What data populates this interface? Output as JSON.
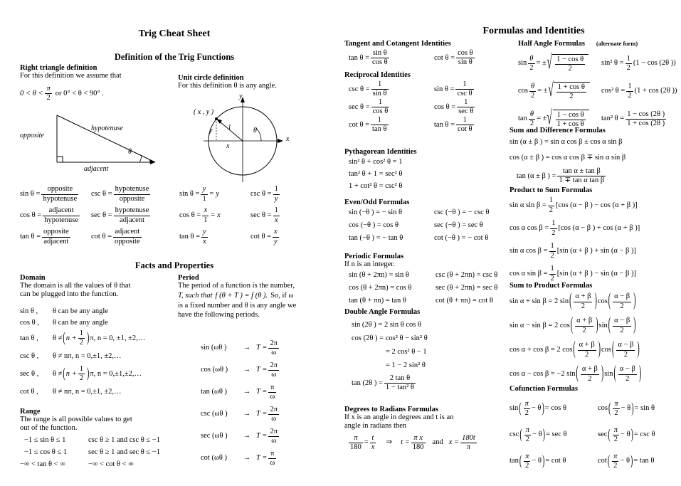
{
  "doc": {
    "title": "Trig Cheat Sheet",
    "right_title": "Formulas and Identities"
  },
  "left": {
    "section1_title": "Definition of the Trig Functions",
    "right_triangle": {
      "heading": "Right triangle definition",
      "line1": "For this definition we assume that",
      "inequality_a": "0 < θ <",
      "inequality_frac_num": "π",
      "inequality_frac_den": "2",
      "inequality_b": "or 0° < θ < 90° .",
      "diagram_labels": {
        "opposite": "opposite",
        "hypotenuse": "hypotenuse",
        "adjacent": "adjacent",
        "theta": "θ"
      },
      "formulas": [
        {
          "lhs": "sin θ =",
          "num": "opposite",
          "den": "hypotenuse"
        },
        {
          "lhs": "cos θ =",
          "num": "adjacent",
          "den": "hypotenuse"
        },
        {
          "lhs": "tan θ =",
          "num": "opposite",
          "den": "adjacent"
        },
        {
          "lhs": "csc θ =",
          "num": "hypotenuse",
          "den": "opposite"
        },
        {
          "lhs": "sec θ =",
          "num": "hypotenuse",
          "den": "adjacent"
        },
        {
          "lhs": "cot θ =",
          "num": "adjacent",
          "den": "opposite"
        }
      ]
    },
    "unit_circle": {
      "heading": "Unit circle definition",
      "line1": "For this definition θ is any angle.",
      "diagram_labels": {
        "point": "( x , y )",
        "x_axis": "x",
        "y_axis": "y",
        "radius": "1",
        "x_leg": "x",
        "y_leg": "y",
        "theta": "θ"
      },
      "formulas": [
        {
          "lhs": "sin θ =",
          "num": "y",
          "den": "1",
          "tail": "= y"
        },
        {
          "lhs": "cos θ =",
          "num": "x",
          "den": "1",
          "tail": "= x"
        },
        {
          "lhs": "tan θ =",
          "num": "y",
          "den": "x",
          "tail": ""
        },
        {
          "lhs": "csc θ =",
          "num": "1",
          "den": "y",
          "tail": ""
        },
        {
          "lhs": "sec θ =",
          "num": "1",
          "den": "x",
          "tail": ""
        },
        {
          "lhs": "cot θ =",
          "num": "x",
          "den": "y",
          "tail": ""
        }
      ]
    },
    "section2_title": "Facts and Properties",
    "domain": {
      "heading": "Domain",
      "line1": "The domain is all the values of θ that",
      "line2": "can be plugged into the function.",
      "rows": [
        {
          "fn": "sin θ ,",
          "cond": "θ can be any angle",
          "type": "plain"
        },
        {
          "fn": "cos θ ,",
          "cond": "θ can be any angle",
          "type": "plain"
        },
        {
          "fn": "tan θ ,",
          "cond": "",
          "type": "half",
          "tail": "π,  n = 0, ±1, ±2,…"
        },
        {
          "fn": "csc θ ,",
          "cond": "θ ≠ nπ,  n = 0,±1, ±2,…",
          "type": "plain"
        },
        {
          "fn": "sec θ ,",
          "cond": "",
          "type": "half",
          "tail": "π,  n = 0,±1,±2,…"
        },
        {
          "fn": "cot θ ,",
          "cond": "θ ≠ nπ,  n = 0,±1, ±2,…",
          "type": "plain"
        }
      ],
      "half_prefix": "θ ≠",
      "half_n": "n +",
      "half_num": "1",
      "half_den": "2"
    },
    "range": {
      "heading": "Range",
      "line1": "The range is all possible values to get",
      "line2": "out of the function.",
      "rows": [
        {
          "left": "−1 ≤ sin θ ≤ 1",
          "right": "csc θ ≥ 1 and csc θ ≤ −1"
        },
        {
          "left": "−1 ≤ cos θ ≤ 1",
          "right": "sec θ ≥ 1 and sec θ ≤ −1"
        },
        {
          "left": "−∞ < tan θ < ∞",
          "right": "−∞ < cot θ < ∞"
        }
      ]
    },
    "period": {
      "heading": "Period",
      "line1": "The period of a function is the number,",
      "line2_a": "T, such that",
      "line2_b": "f (θ + T ) = f (θ ).",
      "line2_c": "So, if ω",
      "line3": "is a fixed number and θ is any angle we",
      "line4": "have the following periods.",
      "rows": [
        {
          "fn": "sin (ωθ )",
          "arrow": "→",
          "eq": "T =",
          "num": "2π",
          "den": "ω"
        },
        {
          "fn": "cos (ωθ )",
          "arrow": "→",
          "eq": "T =",
          "num": "2π",
          "den": "ω"
        },
        {
          "fn": "tan (ωθ )",
          "arrow": "→",
          "eq": "T =",
          "num": "π",
          "den": "ω"
        },
        {
          "fn": "csc (ωθ )",
          "arrow": "→",
          "eq": "T =",
          "num": "2π",
          "den": "ω"
        },
        {
          "fn": "sec (ωθ )",
          "arrow": "→",
          "eq": "T =",
          "num": "2π",
          "den": "ω"
        },
        {
          "fn": "cot (ωθ )",
          "arrow": "→",
          "eq": "T =",
          "num": "π",
          "den": "ω"
        }
      ]
    }
  },
  "mid": {
    "tangent_cotangent": {
      "heading": "Tangent and Cotangent Identities",
      "rows": [
        {
          "lhs": "tan θ =",
          "num": "sin θ",
          "den": "cos θ"
        },
        {
          "lhs": "cot θ =",
          "num": "cos θ",
          "den": "sin θ"
        }
      ]
    },
    "reciprocal": {
      "heading": "Reciprocal Identities",
      "rows": [
        {
          "lhs": "csc θ =",
          "num": "1",
          "den": "sin θ"
        },
        {
          "lhs": "sin θ =",
          "num": "1",
          "den": "csc θ"
        },
        {
          "lhs": "sec θ =",
          "num": "1",
          "den": "cos θ"
        },
        {
          "lhs": "cos θ =",
          "num": "1",
          "den": "sec θ"
        },
        {
          "lhs": "cot θ =",
          "num": "1",
          "den": "tan θ"
        },
        {
          "lhs": "tan θ =",
          "num": "1",
          "den": "cot θ"
        }
      ]
    },
    "pythagorean": {
      "heading": "Pythagorean Identities",
      "rows": [
        "sin² θ + cos² θ = 1",
        "tan² θ + 1 = sec² θ",
        "1 + cot² θ = csc² θ"
      ]
    },
    "even_odd": {
      "heading": "Even/Odd Formulas",
      "rows": [
        {
          "left": "sin (−θ ) = − sin θ",
          "right": "csc (−θ ) = − csc θ"
        },
        {
          "left": "cos (−θ ) = cos θ",
          "right": "sec (−θ ) = sec θ"
        },
        {
          "left": "tan (−θ ) = − tan θ",
          "right": "cot (−θ ) = − cot θ"
        }
      ]
    },
    "periodic": {
      "heading": "Periodic Formulas",
      "line1": "If n is an integer.",
      "rows": [
        {
          "left": "sin (θ + 2πn) = sin θ",
          "right": "csc (θ + 2πn) = csc θ"
        },
        {
          "left": "cos (θ + 2πn) = cos θ",
          "right": "sec (θ + 2πn) = sec θ"
        },
        {
          "left": "tan (θ + πn) = tan θ",
          "right": "cot (θ + πn) = cot θ"
        }
      ]
    },
    "double_angle": {
      "heading": "Double Angle Formulas",
      "rows": [
        "sin (2θ ) = 2 sin θ cos θ",
        "cos (2θ ) = cos² θ − sin² θ",
        "= 2 cos² θ − 1",
        "= 1 − 2 sin² θ"
      ],
      "tan_lhs": "tan (2θ ) =",
      "tan_num": "2 tan θ",
      "tan_den": "1 − tan² θ"
    },
    "deg_rad": {
      "heading": "Degrees to Radians Formulas",
      "line1": "If x is an angle in degrees and t is an",
      "line2": "angle in radians then",
      "f1_num": "π",
      "f1_den": "180",
      "eq1": "=",
      "f2_num": "t",
      "f2_den": "x",
      "implies": "⇒",
      "eq2": "t =",
      "f3_num": "π x",
      "f3_den": "180",
      "and": "and",
      "eq3": "x =",
      "f4_num": "180t",
      "f4_den": "π"
    }
  },
  "right": {
    "half_angle": {
      "heading": "Half Angle Formulas",
      "alt_note": "(alternate form)",
      "rows": [
        {
          "lhs": "sin",
          "fnum": "θ",
          "fden": "2",
          "eq": "= ±",
          "rnum": "1 − cos θ",
          "rden": "2"
        },
        {
          "lhs": "cos",
          "fnum": "θ",
          "fden": "2",
          "eq": "= ±",
          "rnum": "1 + cos θ",
          "rden": "2"
        },
        {
          "lhs": "tan",
          "fnum": "θ",
          "fden": "2",
          "eq": "= ±",
          "rnum": "1 − cos θ",
          "rden": "1 + cos θ"
        }
      ],
      "alt_rows": [
        {
          "lhs": "sin² θ =",
          "fnum": "1",
          "fden": "2",
          "tail": "(1 − cos (2θ ))",
          "kind": "half"
        },
        {
          "lhs": "cos² θ =",
          "fnum": "1",
          "fden": "2",
          "tail": "(1 + cos (2θ ))",
          "kind": "half"
        },
        {
          "lhs": "tan² θ =",
          "fnum": "1 − cos (2θ )",
          "fden": "1 + cos (2θ )",
          "tail": "",
          "kind": "frac"
        }
      ]
    },
    "sum_difference": {
      "heading": "Sum and Difference Formulas",
      "rows": [
        "sin (α ± β ) = sin α cos β ± cos α sin β",
        "cos (α ± β ) = cos α cos β ∓ sin α sin β"
      ],
      "tan_lhs": "tan (α ± β ) =",
      "tan_num": "tan α ± tan β",
      "tan_den": "1 ∓ tan α tan β"
    },
    "product_to_sum": {
      "heading": "Product to Sum Formulas",
      "rows": [
        {
          "lhs": "sin α sin β =",
          "num": "1",
          "den": "2",
          "body": "[cos (α − β ) − cos (α + β )]"
        },
        {
          "lhs": "cos α cos β =",
          "num": "1",
          "den": "2",
          "body": "[cos (α − β ) + cos (α + β )]"
        },
        {
          "lhs": "sin α cos β =",
          "num": "1",
          "den": "2",
          "body": "[sin (α + β ) + sin (α − β )]"
        },
        {
          "lhs": "cos α sin β =",
          "num": "1",
          "den": "2",
          "body": "[sin (α + β ) − sin (α − β )]"
        }
      ]
    },
    "sum_to_product": {
      "heading": "Sum to Product Formulas",
      "rows": [
        {
          "lhs": "sin α + sin β = 2 sin",
          "f1n": "α + β",
          "f1d": "2",
          "mid": "cos",
          "f2n": "α − β",
          "f2d": "2"
        },
        {
          "lhs": "sin α − sin β = 2 cos",
          "f1n": "α + β",
          "f1d": "2",
          "mid": "sin",
          "f2n": "α − β",
          "f2d": "2"
        },
        {
          "lhs": "cos α + cos β = 2 cos",
          "f1n": "α + β",
          "f1d": "2",
          "mid": "cos",
          "f2n": "α − β",
          "f2d": "2"
        },
        {
          "lhs": "cos α − cos β = −2 sin",
          "f1n": "α + β",
          "f1d": "2",
          "mid": "sin",
          "f2n": "α − β",
          "f2d": "2"
        }
      ]
    },
    "cofunction": {
      "heading": "Cofunction Formulas",
      "rows": [
        {
          "lhs": "sin",
          "num": "π",
          "den": "2",
          "sub": "− θ",
          "rhs": "= cos θ"
        },
        {
          "lhs": "cos",
          "num": "π",
          "den": "2",
          "sub": "− θ",
          "rhs": "= sin θ"
        },
        {
          "lhs": "csc",
          "num": "π",
          "den": "2",
          "sub": "− θ",
          "rhs": "= sec θ"
        },
        {
          "lhs": "sec",
          "num": "π",
          "den": "2",
          "sub": "− θ",
          "rhs": "= csc θ"
        },
        {
          "lhs": "tan",
          "num": "π",
          "den": "2",
          "sub": "− θ",
          "rhs": "= cot θ"
        },
        {
          "lhs": "cot",
          "num": "π",
          "den": "2",
          "sub": "− θ",
          "rhs": "= tan θ"
        }
      ]
    }
  }
}
